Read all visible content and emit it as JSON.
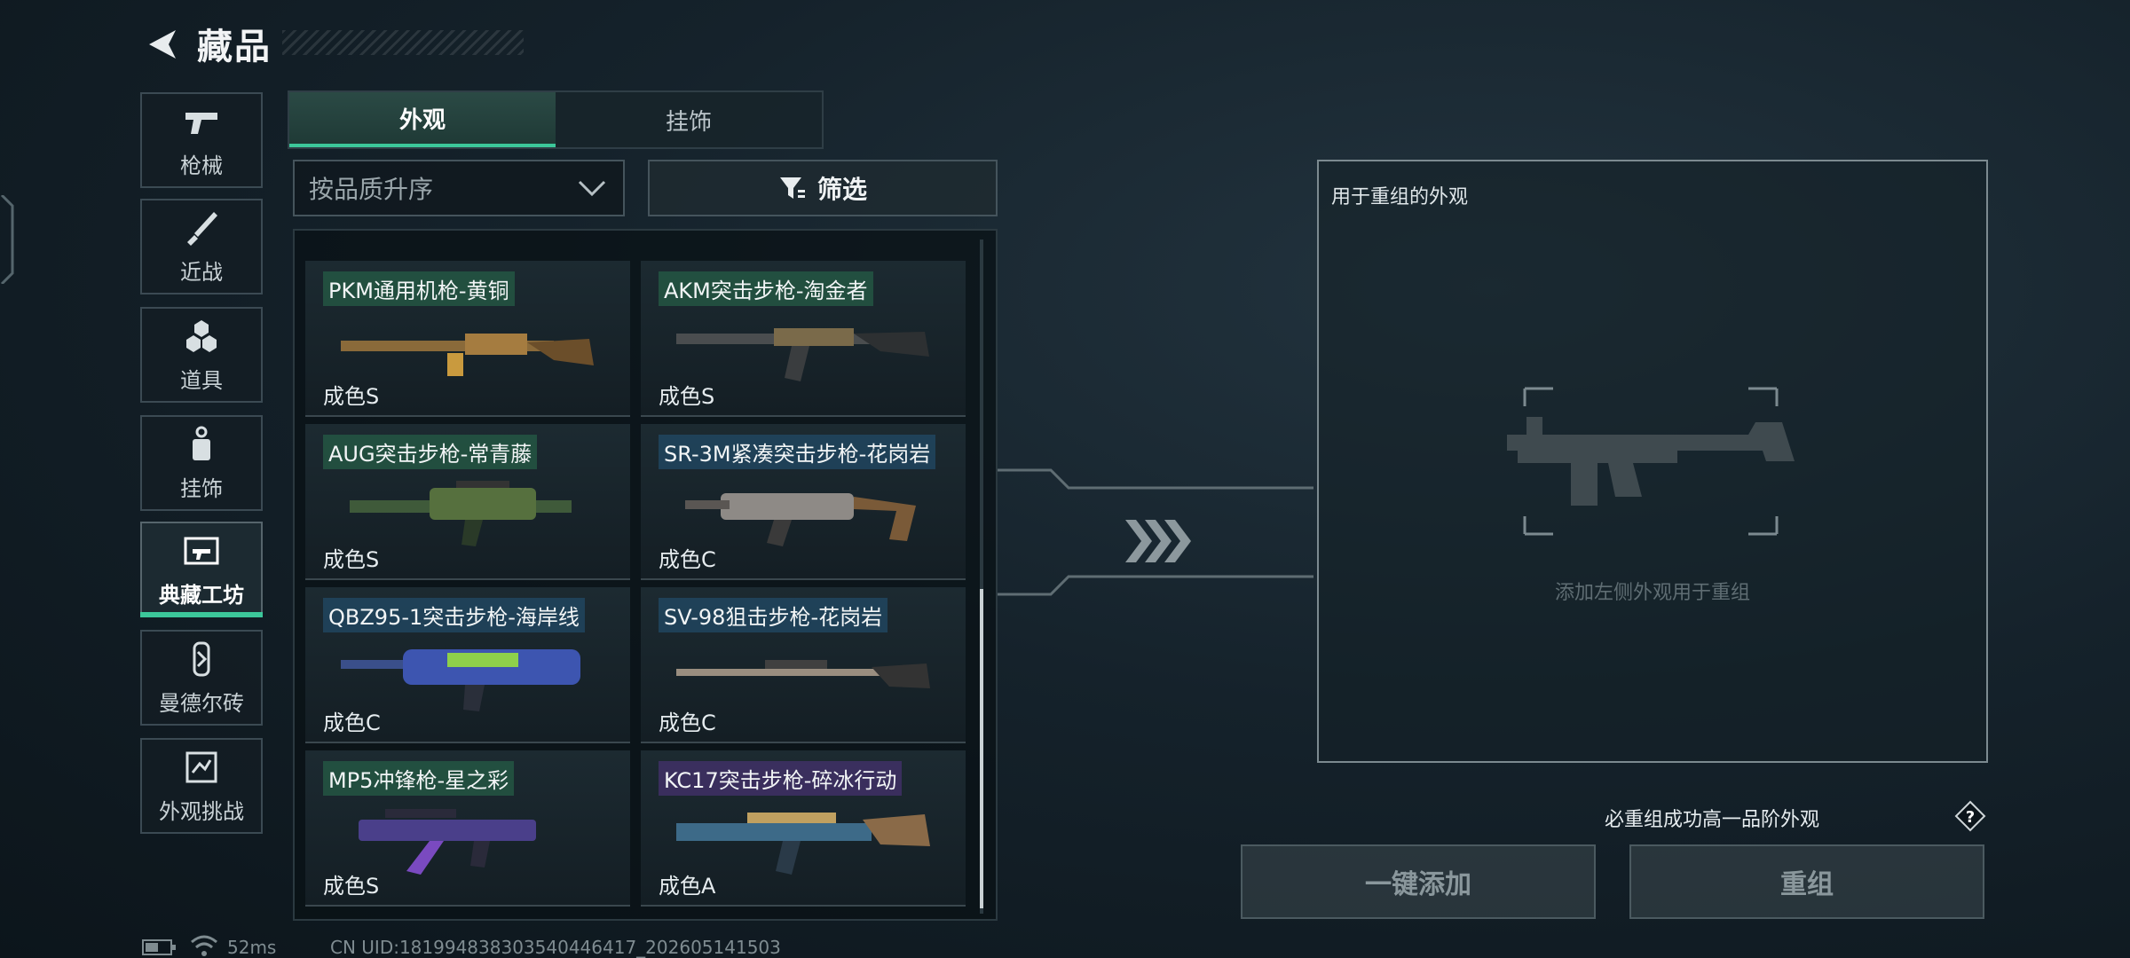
{
  "header": {
    "title": "藏品"
  },
  "sidebar": {
    "items": [
      {
        "label": "枪械",
        "icon": "pistol-icon"
      },
      {
        "label": "近战",
        "icon": "knife-icon"
      },
      {
        "label": "道具",
        "icon": "grenades-icon"
      },
      {
        "label": "挂饰",
        "icon": "charm-icon"
      },
      {
        "label": "典藏工坊",
        "icon": "workshop-icon",
        "active": true
      },
      {
        "label": "曼德尔砖",
        "icon": "brick-icon"
      },
      {
        "label": "外观挑战",
        "icon": "challenge-icon"
      }
    ]
  },
  "tabs": [
    {
      "label": "外观",
      "active": true
    },
    {
      "label": "挂饰"
    }
  ],
  "sort": {
    "value": "按品质升序"
  },
  "filter": {
    "label": "筛选"
  },
  "grid": {
    "items": [
      {
        "name": "PKM通用机枪-黄铜",
        "grade": "成色S",
        "quality": "S"
      },
      {
        "name": "AKM突击步枪-淘金者",
        "grade": "成色S",
        "quality": "S"
      },
      {
        "name": "AUG突击步枪-常青藤",
        "grade": "成色S",
        "quality": "S"
      },
      {
        "name": "SR-3M紧凑突击步枪-花岗岩",
        "grade": "成色C",
        "quality": "C"
      },
      {
        "name": "QBZ95-1突击步枪-海岸线",
        "grade": "成色C",
        "quality": "C"
      },
      {
        "name": "SV-98狙击步枪-花岗岩",
        "grade": "成色C",
        "quality": "C"
      },
      {
        "name": "MP5冲锋枪-星之彩",
        "grade": "成色S",
        "quality": "S"
      },
      {
        "name": "KC17突击步枪-碎冰行动",
        "grade": "成色A",
        "quality": "A"
      }
    ]
  },
  "remix": {
    "panel_label": "用于重组的外观",
    "hint": "添加左侧外观用于重组",
    "guarantee": "必重组成功高一品阶外观",
    "add_button": "一键添加",
    "remix_button": "重组"
  },
  "status": {
    "ping": "52ms",
    "uid": "CN UID:181994838303540446417_202605141503"
  },
  "colors": {
    "accent": "#3cc79a",
    "quality_S": "#265c46",
    "quality_C": "#224a66",
    "quality_A": "#46326e"
  }
}
